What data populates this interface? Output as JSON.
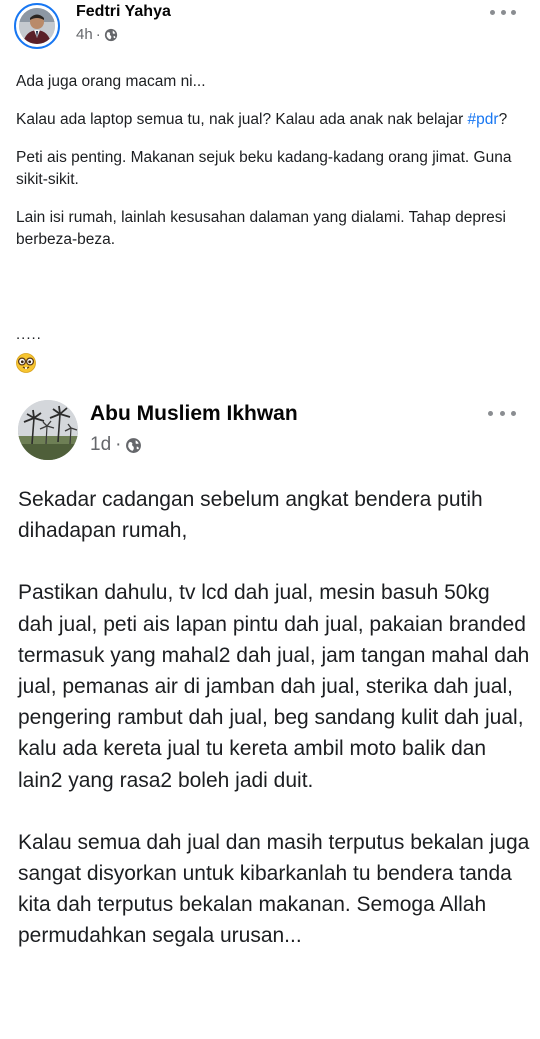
{
  "outer_post": {
    "author": "Fedtri Yahya",
    "time": "4h",
    "separator": "·",
    "body": {
      "p1": "Ada juga orang macam ni...",
      "p2_before": "Kalau ada laptop semua tu, nak jual? Kalau ada anak nak belajar ",
      "p2_hashtag": "#pdr",
      "p2_after": "?",
      "p3": "Peti ais penting. Makanan sejuk beku kadang-kadang orang jimat. Guna sikit-sikit.",
      "p4": "Lain isi rumah, lainlah kesusahan dalaman yang dialami. Tahap depresi berbeza-beza."
    },
    "dots": ".....",
    "emoji_icon": "nerd-face-emoji",
    "accent_color": "#1877f2"
  },
  "shared_post": {
    "author": "Abu Musliem Ikhwan",
    "time": "1d",
    "separator": "·",
    "body": {
      "p1": "Sekadar cadangan sebelum angkat bendera putih dihadapan rumah,",
      "p2": "Pastikan dahulu, tv lcd dah jual, mesin basuh 50kg dah jual, peti ais lapan pintu dah jual, pakaian branded termasuk yang mahal2 dah jual, jam tangan mahal dah jual, pemanas air di jamban dah jual, sterika dah jual, pengering rambut dah jual, beg sandang kulit dah jual, kalu ada kereta jual tu kereta ambil moto balik dan lain2 yang rasa2 boleh jadi duit.",
      "p3": "Kalau semua dah jual  dan masih terputus bekalan juga sangat disyorkan untuk kibarkanlah tu bendera tanda kita dah terputus bekalan makanan. Semoga Allah permudahkan segala urusan..."
    }
  },
  "icons": {
    "privacy": "globe-icon",
    "more": "more-options-icon"
  }
}
